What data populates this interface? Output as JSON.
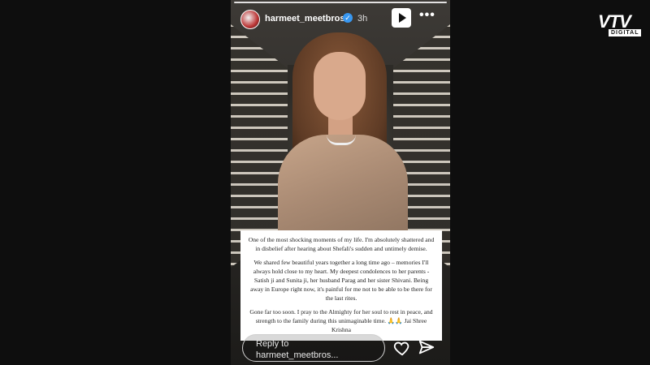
{
  "story": {
    "username": "harmeet_meetbros",
    "time": "3h",
    "progress": 1.0,
    "card_paragraphs": [
      "One of the most shocking moments of my life. I'm absolutely shattered and in disbelief after hearing about Shefali's sudden and untimely demise.",
      "We shared few beautiful years together a long time ago – memories I'll always hold close to my heart. My deepest condolences to her parents - Satish ji and Sunita ji, her husband Parag and her sister Shivani. Being away in Europe right now, it's painful for me not to be able to be there for the last rites.",
      "Gone far too soon. I pray to the Almighty for her soul to rest in peace, and strength to the family during this unimaginable time. 🙏🙏 Jai Shree Krishna"
    ],
    "reply_label": "Reply to",
    "reply_user": "harmeet_meetbros..."
  },
  "icons": {
    "verified": "verified-badge-icon",
    "play": "play-icon",
    "more": "more-icon",
    "heart": "heart-icon",
    "send": "send-icon"
  },
  "logo": {
    "main": "VTV",
    "sub": "DIGITAL"
  },
  "colors": {
    "verified": "#3897f0",
    "background": "#0b0b0b"
  }
}
